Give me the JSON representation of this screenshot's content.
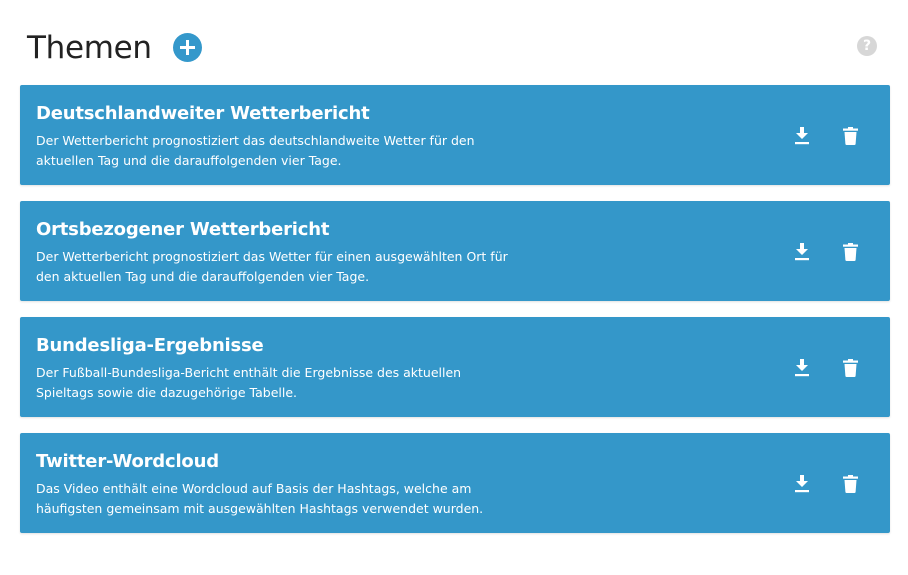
{
  "header": {
    "title": "Themen",
    "add_icon": "plus-circle-icon",
    "help_icon": "question-circle-icon",
    "help_glyph": "?"
  },
  "colors": {
    "accent": "#3498cb",
    "card_background": "#3497c9",
    "title_text": "#222222",
    "card_text": "#ffffff",
    "help_icon": "#d7d7d7"
  },
  "topics": [
    {
      "title": "Deutschlandweiter Wetterbericht",
      "description_line1": "Der Wetterbericht prognostiziert das deutschlandweite Wetter für den",
      "description_line2": "aktuellen Tag und die darauffolgenden vier Tage.",
      "actions": [
        "download-icon",
        "trash-icon"
      ]
    },
    {
      "title": "Ortsbezogener Wetterbericht",
      "description_line1": "Der Wetterbericht prognostiziert das Wetter für einen ausgewählten Ort für",
      "description_line2": "den aktuellen Tag und die darauffolgenden vier Tage.",
      "actions": [
        "download-icon",
        "trash-icon"
      ]
    },
    {
      "title": "Bundesliga-Ergebnisse",
      "description_line1": "Der Fußball-Bundesliga-Bericht enthält die Ergebnisse des aktuellen",
      "description_line2": "Spieltags sowie die dazugehörige Tabelle.",
      "actions": [
        "download-icon",
        "trash-icon"
      ]
    },
    {
      "title": "Twitter-Wordcloud",
      "description_line1": "Das Video enthält eine Wordcloud auf Basis der Hashtags, welche am",
      "description_line2": "häufigsten gemeinsam mit ausgewählten Hashtags verwendet wurden.",
      "actions": [
        "download-icon",
        "trash-icon"
      ]
    }
  ]
}
